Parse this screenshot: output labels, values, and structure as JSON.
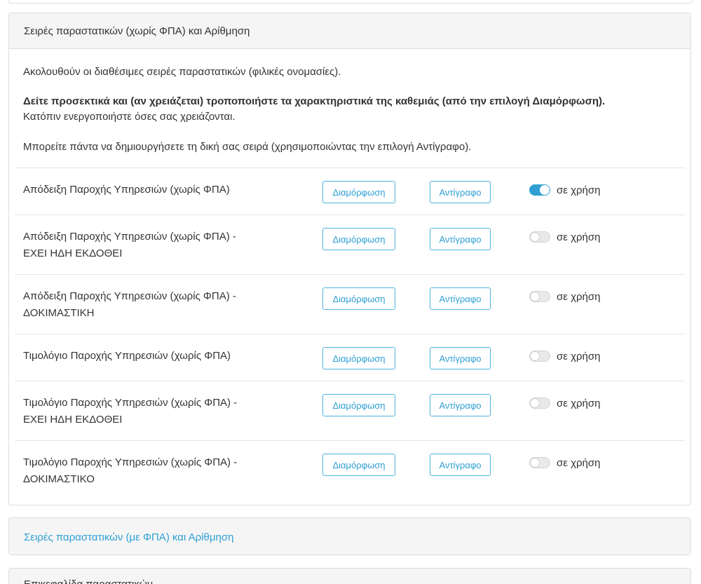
{
  "panels": {
    "main": {
      "title": "Σειρές παραστατικών (χωρίς ΦΠΑ) και Αρίθμηση",
      "intro": {
        "line1": "Ακολουθούν οι διαθέσιμες σειρές παραστατικών (φιλικές ονομασίες).",
        "line2_bold": "Δείτε προσεκτικά και (αν χρειάζεται) τροποποιήστε τα χαρακτηριστικά της καθεμιάς (από την επιλογή Διαμόρφωση).",
        "line2_rest": "Κατόπιν ενεργοποιήστε όσες σας χρειάζονται.",
        "line3": "Μπορείτε πάντα να δημιουργήσετε τη δική σας σειρά (χρησιμοποιώντας την επιλογή Αντίγραφο)."
      },
      "button_labels": {
        "configure": "Διαμόρφωση",
        "copy": "Αντίγραφο"
      },
      "toggle_label": "σε χρήση",
      "rows": [
        {
          "name_line1": "Απόδειξη Παροχής Υπηρεσιών (χωρίς ΦΠΑ)",
          "name_line2": "",
          "enabled": true
        },
        {
          "name_line1": "Απόδειξη Παροχής Υπηρεσιών (χωρίς ΦΠΑ) -",
          "name_line2": "ΕΧΕΙ ΗΔΗ ΕΚΔΟΘΕΙ",
          "enabled": false
        },
        {
          "name_line1": "Απόδειξη Παροχής Υπηρεσιών (χωρίς ΦΠΑ) -",
          "name_line2": "ΔΟΚΙΜΑΣΤΙΚΗ",
          "enabled": false
        },
        {
          "name_line1": "Τιμολόγιο Παροχής Υπηρεσιών (χωρίς ΦΠΑ)",
          "name_line2": "",
          "enabled": false
        },
        {
          "name_line1": "Τιμολόγιο Παροχής Υπηρεσιών (χωρίς ΦΠΑ) -",
          "name_line2": "ΕΧΕΙ ΗΔΗ ΕΚΔΟΘΕΙ",
          "enabled": false
        },
        {
          "name_line1": "Τιμολόγιο Παροχής Υπηρεσιών (χωρίς ΦΠΑ) -",
          "name_line2": "ΔΟΚΙΜΑΣΤΙΚΟ",
          "enabled": false
        }
      ]
    },
    "vat_series": {
      "title": "Σειρές παραστατικών (με ΦΠΑ) και Αρίθμηση"
    },
    "cut_off": {
      "title": "Επικεφαλίδα παραστατικών"
    }
  },
  "colors": {
    "accent": "#2f9fd4",
    "panel_heading_bg": "#f5f5f5",
    "border": "#dddddd"
  }
}
